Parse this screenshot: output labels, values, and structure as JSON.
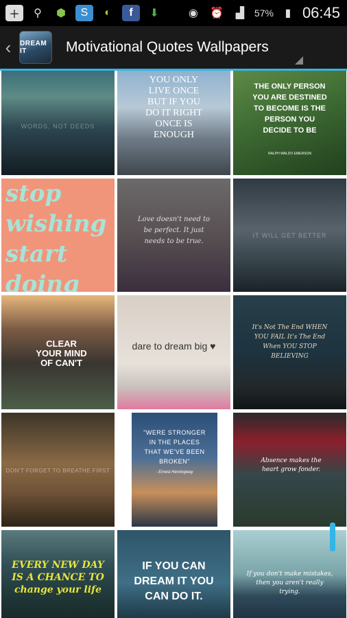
{
  "status_bar": {
    "left_icons": [
      "add-icon",
      "usb-icon",
      "android-icon",
      "app-store-icon",
      "planet-icon",
      "facebook-icon",
      "download-icon"
    ],
    "battery": "57%",
    "time": "06:45"
  },
  "action_bar": {
    "app_icon_text": "DREAM IT",
    "title": "Motivational Quotes Wallpapers"
  },
  "wallpapers": [
    {
      "quote": "WORDS, NOT DEEDS"
    },
    {
      "quote": "YOU ONLY LIVE ONCE BUT IF YOU DO IT RIGHT ONCE IS ENOUGH"
    },
    {
      "quote": "THE ONLY PERSON YOU ARE DESTINED TO BECOME IS THE PERSON YOU DECIDE TO BE",
      "author": "RALPH WALDO EMERSON"
    },
    {
      "quote": "stop wishing start doing"
    },
    {
      "quote": "Love doesn't need to be perfect. It just needs to be true."
    },
    {
      "quote": "IT WILL GET BETTER"
    },
    {
      "quote": "CLEAR YOUR MIND OF CAN'T"
    },
    {
      "quote": "dare to dream big ♥"
    },
    {
      "quote": "It's Not The End WHEN YOU FAIL It's The End When YOU STOP BELIEVING"
    },
    {
      "quote": "DON'T FORGET TO BREATHE FIRST"
    },
    {
      "quote": "\"WERE STRONGER IN THE PLACES THAT WE'VE BEEN BROKEN\"",
      "author": "- Ernest Hemingway"
    },
    {
      "quote": "Absence makes the heart grow fonder."
    },
    {
      "quote": "EVERY NEW DAY IS A CHANCE TO change your life"
    },
    {
      "quote": "IF YOU CAN DREAM IT YOU CAN DO IT."
    },
    {
      "quote": "If you don't make mistakes, then you aren't really trying."
    }
  ]
}
